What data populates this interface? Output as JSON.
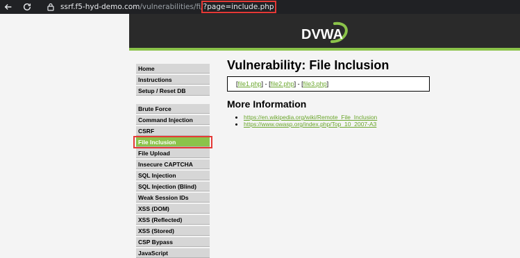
{
  "browser": {
    "url_host": "ssrf.f5-hyd-demo.com",
    "url_path": "/vulnerabilities/fi/",
    "url_query": "?page=include.php"
  },
  "header": {
    "logo_text": "DVWA",
    "accent_color": "#8bc34a"
  },
  "menu": {
    "group1": [
      "Home",
      "Instructions",
      "Setup / Reset DB"
    ],
    "group2": [
      "Brute Force",
      "Command Injection",
      "CSRF",
      "File Inclusion",
      "File Upload",
      "Insecure CAPTCHA",
      "SQL Injection",
      "SQL Injection (Blind)",
      "Weak Session IDs",
      "XSS (DOM)",
      "XSS (Reflected)",
      "XSS (Stored)",
      "CSP Bypass",
      "JavaScript"
    ],
    "selected": "File Inclusion"
  },
  "main": {
    "title": "Vulnerability: File Inclusion",
    "files": [
      "file1.php",
      "file2.php",
      "file3.php"
    ],
    "separator": " - ",
    "more_title": "More Information",
    "links": [
      "https://en.wikipedia.org/wiki/Remote_File_Inclusion",
      "https://www.owasp.org/index.php/Top_10_2007-A3"
    ]
  }
}
